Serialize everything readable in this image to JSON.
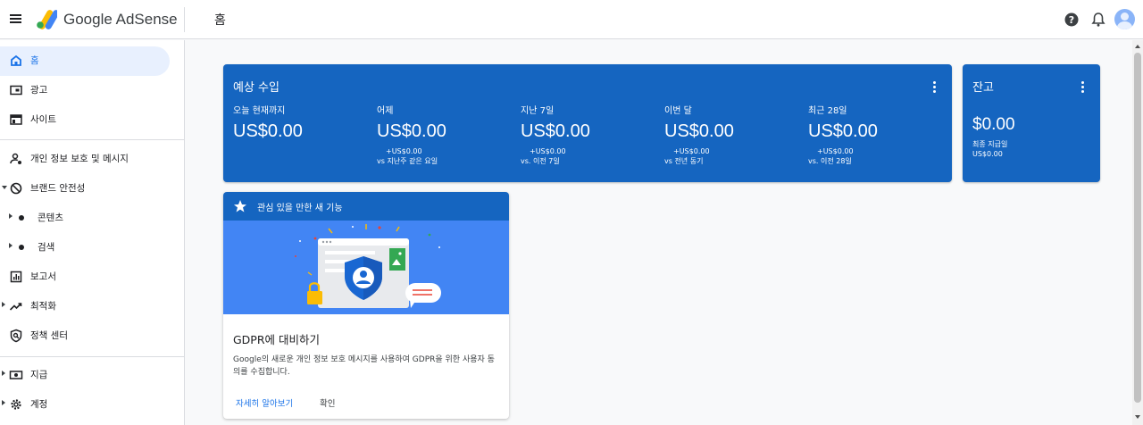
{
  "header": {
    "brand": "Google AdSense",
    "page_title": "홈"
  },
  "sidebar": {
    "items": [
      {
        "label": "홈"
      },
      {
        "label": "광고"
      },
      {
        "label": "사이트"
      },
      {
        "label": "개인 정보 보호 및 메시지"
      },
      {
        "label": "브랜드 안전성"
      },
      {
        "label": "콘텐츠"
      },
      {
        "label": "검색"
      },
      {
        "label": "보고서"
      },
      {
        "label": "최적화"
      },
      {
        "label": "정책 센터"
      },
      {
        "label": "지급"
      },
      {
        "label": "계정"
      }
    ]
  },
  "revenue": {
    "title": "예상 수입",
    "metrics": [
      {
        "label": "오늘 현재까지",
        "value": "US$0.00",
        "delta": "",
        "compare": ""
      },
      {
        "label": "어제",
        "value": "US$0.00",
        "delta": "+US$0.00",
        "compare": "vs 지난주 같은 요일"
      },
      {
        "label": "지난 7일",
        "value": "US$0.00",
        "delta": "+US$0.00",
        "compare": "vs. 이전 7일"
      },
      {
        "label": "이번 달",
        "value": "US$0.00",
        "delta": "+US$0.00",
        "compare": "vs 전년 동기"
      },
      {
        "label": "최근 28일",
        "value": "US$0.00",
        "delta": "+US$0.00",
        "compare": "vs. 이전 28일"
      }
    ]
  },
  "balance": {
    "title": "잔고",
    "value": "$0.00",
    "label": "최종 지급일",
    "sub": "US$0.00"
  },
  "feature": {
    "header": "관심 있을 만한 새 기능",
    "title": "GDPR에 대비하기",
    "body": "Google의 새로운 개인 정보 보호 메시지를 사용하여 GDPR을 위한 사용자 동의를 수집합니다.",
    "learn_more": "자세히 알아보기",
    "confirm": "확인"
  },
  "colors": {
    "card_blue": "#1565c0",
    "accent": "#1a73e8",
    "active_nav_bg": "#e8f0fe"
  }
}
